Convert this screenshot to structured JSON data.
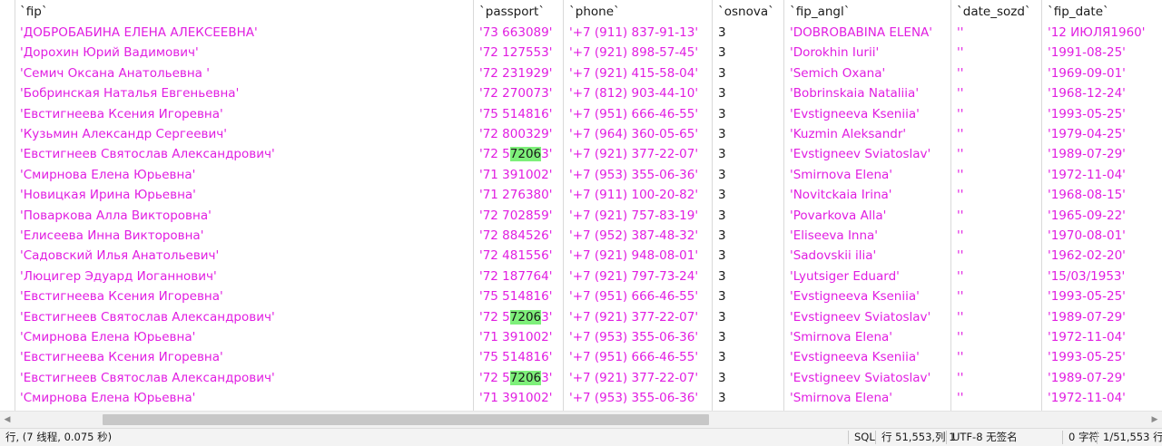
{
  "columns": [
    "`fip`",
    "`passport`",
    "`phone`",
    "`osnova`",
    "`fip_angl`",
    "`date_sozd`",
    "`fip_date`"
  ],
  "rows": [
    [
      "'ДОБРОБАБИНА ЕЛЕНА АЛЕКСЕЕВНА'",
      "'73 663089'",
      "'+7 (911) 837-91-13'",
      "3",
      "'DOBROBABINA ELENA'",
      "''",
      "'12 ИЮЛЯ1960'"
    ],
    [
      "'Дорохин Юрий  Вадимович'",
      "'72 127553'",
      "'+7 (921) 898-57-45'",
      "3",
      "'Dorokhin Iurii'",
      "''",
      "'1991-08-25'"
    ],
    [
      "'Семич Оксана Анатольевна '",
      "'72 231929'",
      "'+7 (921) 415-58-04'",
      "3",
      "'Semich Oxana'",
      "''",
      "'1969-09-01'"
    ],
    [
      "'Бобринская Наталья Евгеньевна'",
      "'72 270073'",
      "'+7 (812) 903-44-10'",
      "3",
      "'Bobrinskaia Nataliia'",
      "''",
      "'1968-12-24'"
    ],
    [
      "'Евстигнеева Ксения Игоревна'",
      "'75 514816'",
      "'+7 (951) 666-46-55'",
      "3",
      "'Evstigneeva Kseniia'",
      "''",
      "'1993-05-25'"
    ],
    [
      "'Кузьмин Александр Сергеевич'",
      "'72 800329'",
      "'+7 (964) 360-05-65'",
      "3",
      "'Kuzmin Aleksandr'",
      "''",
      "'1979-04-25'"
    ],
    [
      "'Евстигнеев Святослав Александрович'",
      "'72 572063'",
      "'+7 (921) 377-22-07'",
      "3",
      "'Evstigneev Sviatoslav'",
      "''",
      "'1989-07-29'"
    ],
    [
      "'Смирнова Елена Юрьевна'",
      "'71 391002'",
      "'+7 (953) 355-06-36'",
      "3",
      "'Smirnova Elena'",
      "''",
      "'1972-11-04'"
    ],
    [
      "'Новицкая Ирина Юрьевна'",
      "'71 276380'",
      "'+7 (911) 100-20-82'",
      "3",
      "'Novitckaia Irina'",
      "''",
      "'1968-08-15'"
    ],
    [
      "'Поваркова Алла Викторовна'",
      "'72 702859'",
      "'+7 (921) 757-83-19'",
      "3",
      "'Povarkova Alla'",
      "''",
      "'1965-09-22'"
    ],
    [
      "'Елисеева Инна Викторовна'",
      "'72 884526'",
      "'+7 (952) 387-48-32'",
      "3",
      "'Eliseeva Inna'",
      "''",
      "'1970-08-01'"
    ],
    [
      "'Садовский Илья Анатольевич'",
      "'72 481556'",
      "'+7 (921) 948-08-01'",
      "3",
      "'Sadovskii ilia'",
      "''",
      "'1962-02-20'"
    ],
    [
      "'Люцигер Эдуард Иоганнович'",
      "'72 187764'",
      "'+7 (921) 797-73-24'",
      "3",
      "'Lyutsiger Eduard'",
      "''",
      "'15/03/1953'"
    ],
    [
      "'Евстигнеева Ксения Игоревна'",
      "'75 514816'",
      "'+7 (951) 666-46-55'",
      "3",
      "'Evstigneeva Kseniia'",
      "''",
      "'1993-05-25'"
    ],
    [
      "'Евстигнеев Святослав Александрович'",
      "'72 572063'",
      "'+7 (921) 377-22-07'",
      "3",
      "'Evstigneev Sviatoslav'",
      "''",
      "'1989-07-29'"
    ],
    [
      "'Смирнова Елена Юрьевна'",
      "'71 391002'",
      "'+7 (953) 355-06-36'",
      "3",
      "'Smirnova Elena'",
      "''",
      "'1972-11-04'"
    ],
    [
      "'Евстигнеева Ксения Игоревна'",
      "'75 514816'",
      "'+7 (951) 666-46-55'",
      "3",
      "'Evstigneeva Kseniia'",
      "''",
      "'1993-05-25'"
    ],
    [
      "'Евстигнеев Святослав Александрович'",
      "'72 572063'",
      "'+7 (921) 377-22-07'",
      "3",
      "'Evstigneev Sviatoslav'",
      "''",
      "'1989-07-29'"
    ],
    [
      "'Смирнова Елена Юрьевна'",
      "'71 391002'",
      "'+7 (953) 355-06-36'",
      "3",
      "'Smirnova Elena'",
      "''",
      "'1972-11-04'"
    ]
  ],
  "highlight": {
    "match": "7206",
    "column": 1
  },
  "status": {
    "left": "行, (7 线程, 0.075 秒)",
    "lang": "SQL",
    "position": "行 51,553,列 1",
    "encoding": "UTF-8 无签名",
    "selection": "0 字符",
    "count": "1/51,553 行"
  },
  "colors": {
    "value_text": "#e11ee1",
    "match_highlight": "#7ef07a"
  }
}
